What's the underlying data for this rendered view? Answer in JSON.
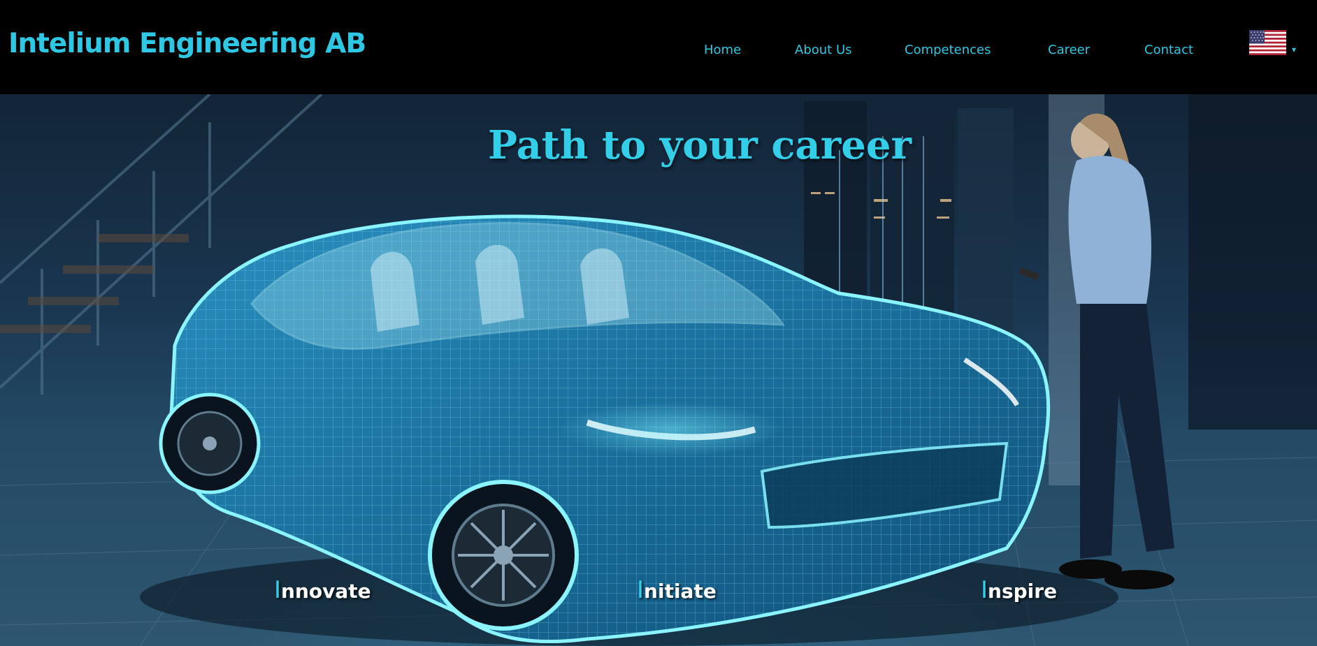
{
  "brand": {
    "name": "Intelium Engineering AB"
  },
  "nav": {
    "items": [
      {
        "label": "Home"
      },
      {
        "label": "About Us"
      },
      {
        "label": "Competences"
      },
      {
        "label": "Career"
      },
      {
        "label": "Contact"
      }
    ]
  },
  "language": {
    "icon": "us-flag-icon",
    "caret": "▾"
  },
  "hero": {
    "title": "Path to your career",
    "pillars": [
      {
        "initial": "I",
        "rest": "nnovate"
      },
      {
        "initial": "I",
        "rest": "nitiate"
      },
      {
        "initial": "I",
        "rest": "nspire"
      }
    ]
  },
  "colors": {
    "accent": "#2ec8e4",
    "background": "#000000",
    "hero_text": "#ffffff"
  }
}
